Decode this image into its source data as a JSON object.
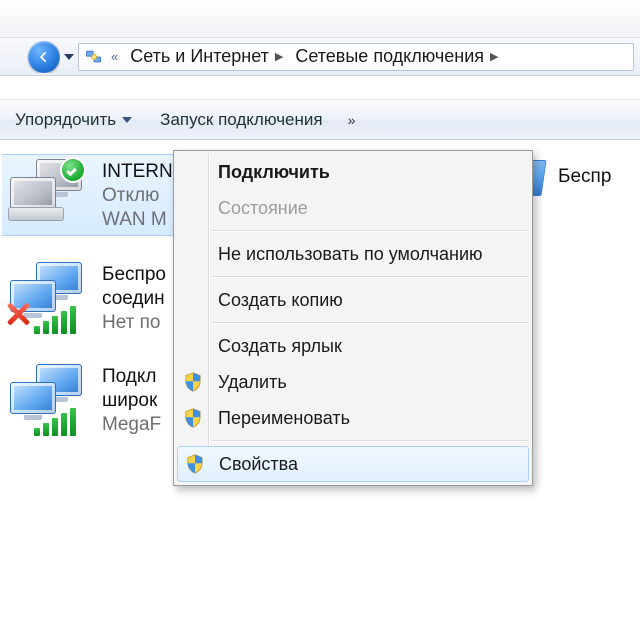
{
  "breadcrumb": {
    "seg1": "Сеть и Интернет",
    "seg2": "Сетевые подключения"
  },
  "toolbar": {
    "organize": "Упорядочить",
    "start_conn": "Запуск подключения",
    "overflow_glyph": "»"
  },
  "connections": {
    "internet": {
      "title": "INTERNET",
      "line2": "Отклю",
      "line3": "WAN M"
    },
    "wifi": {
      "title": "Беспро",
      "line2": "соедин",
      "line3": "Нет по"
    },
    "broadband": {
      "title": "Подкл",
      "line2": "широк",
      "line3": "MegaF"
    },
    "extra_right": {
      "title": "Беспр"
    }
  },
  "context_menu": {
    "connect": "Подключить",
    "status": "Состояние",
    "no_default": "Не использовать по умолчанию",
    "copy": "Создать копию",
    "shortcut": "Создать ярлык",
    "delete": "Удалить",
    "rename": "Переименовать",
    "properties": "Свойства"
  }
}
